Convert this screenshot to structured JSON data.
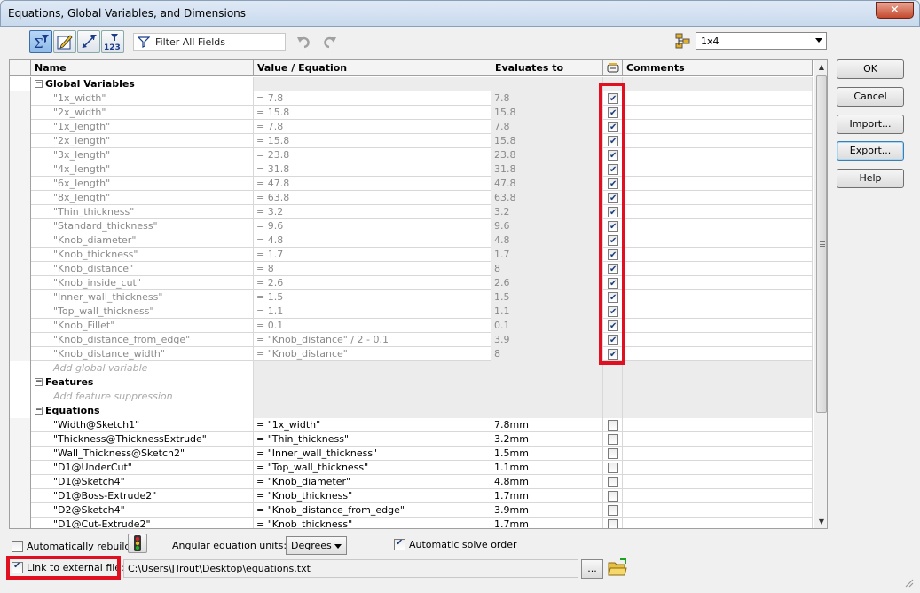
{
  "window": {
    "title": "Equations, Global Variables, and Dimensions",
    "close_label": "✕"
  },
  "toolbar": {
    "buttons": [
      {
        "name": "equation-view-button",
        "icon": "sigma-filter-icon"
      },
      {
        "name": "sketch-equation-view-button",
        "icon": "pencil-edit-icon"
      },
      {
        "name": "dimension-view-button",
        "icon": "dimension-icon"
      },
      {
        "name": "ordered-view-button",
        "icon": "filter-123-icon"
      }
    ],
    "filter_placeholder": "Filter All Fields",
    "configuration": "1x4"
  },
  "columns": [
    "Name",
    "Value / Equation",
    "Evaluates to",
    "",
    "Comments"
  ],
  "sections": {
    "global_variables": "Global Variables",
    "add_global_variable": "Add global variable",
    "features": "Features",
    "add_feature_suppression": "Add feature suppression",
    "equations": "Equations"
  },
  "global_variables": [
    {
      "name": "\"1x_width\"",
      "value": "= 7.8",
      "evaluates": "7.8",
      "checked": true
    },
    {
      "name": "\"2x_width\"",
      "value": "= 15.8",
      "evaluates": "15.8",
      "checked": true
    },
    {
      "name": "\"1x_length\"",
      "value": "= 7.8",
      "evaluates": "7.8",
      "checked": true
    },
    {
      "name": "\"2x_length\"",
      "value": "= 15.8",
      "evaluates": "15.8",
      "checked": true
    },
    {
      "name": "\"3x_length\"",
      "value": "= 23.8",
      "evaluates": "23.8",
      "checked": true
    },
    {
      "name": "\"4x_length\"",
      "value": "= 31.8",
      "evaluates": "31.8",
      "checked": true
    },
    {
      "name": "\"6x_length\"",
      "value": "= 47.8",
      "evaluates": "47.8",
      "checked": true
    },
    {
      "name": "\"8x_length\"",
      "value": "= 63.8",
      "evaluates": "63.8",
      "checked": true
    },
    {
      "name": "\"Thin_thickness\"",
      "value": "= 3.2",
      "evaluates": "3.2",
      "checked": true
    },
    {
      "name": "\"Standard_thickness\"",
      "value": "= 9.6",
      "evaluates": "9.6",
      "checked": true
    },
    {
      "name": "\"Knob_diameter\"",
      "value": "= 4.8",
      "evaluates": "4.8",
      "checked": true
    },
    {
      "name": "\"Knob_thickness\"",
      "value": "= 1.7",
      "evaluates": "1.7",
      "checked": true
    },
    {
      "name": "\"Knob_distance\"",
      "value": "= 8",
      "evaluates": "8",
      "checked": true
    },
    {
      "name": "\"Knob_inside_cut\"",
      "value": "= 2.6",
      "evaluates": "2.6",
      "checked": true
    },
    {
      "name": "\"Inner_wall_thickness\"",
      "value": "= 1.5",
      "evaluates": "1.5",
      "checked": true
    },
    {
      "name": "\"Top_wall_thickness\"",
      "value": "= 1.1",
      "evaluates": "1.1",
      "checked": true
    },
    {
      "name": "\"Knob_Fillet\"",
      "value": "= 0.1",
      "evaluates": "0.1",
      "checked": true
    },
    {
      "name": "\"Knob_distance_from_edge\"",
      "value": "= \"Knob_distance\" / 2 - 0.1",
      "evaluates": "3.9",
      "checked": true
    },
    {
      "name": "\"Knob_distance_width\"",
      "value": "= \"Knob_distance\"",
      "evaluates": "8",
      "checked": true
    }
  ],
  "equations": [
    {
      "name": "\"Width@Sketch1\"",
      "value": "= \"1x_width\"",
      "evaluates": "7.8mm",
      "checked": false
    },
    {
      "name": "\"Thickness@ThicknessExtrude\"",
      "value": "= \"Thin_thickness\"",
      "evaluates": "3.2mm",
      "checked": false
    },
    {
      "name": "\"Wall_Thickness@Sketch2\"",
      "value": "= \"Inner_wall_thickness\"",
      "evaluates": "1.5mm",
      "checked": false
    },
    {
      "name": "\"D1@UnderCut\"",
      "value": "= \"Top_wall_thickness\"",
      "evaluates": "1.1mm",
      "checked": false
    },
    {
      "name": "\"D1@Sketch4\"",
      "value": "= \"Knob_diameter\"",
      "evaluates": "4.8mm",
      "checked": false
    },
    {
      "name": "\"D1@Boss-Extrude2\"",
      "value": "= \"Knob_thickness\"",
      "evaluates": "1.7mm",
      "checked": false
    },
    {
      "name": "\"D2@Sketch4\"",
      "value": "= \"Knob_distance_from_edge\"",
      "evaluates": "3.9mm",
      "checked": false
    },
    {
      "name": "\"D1@Cut-Extrude2\"",
      "value": "= \"Knob_thickness\"",
      "evaluates": "1.7mm",
      "checked": false
    }
  ],
  "side_buttons": {
    "ok": "OK",
    "cancel": "Cancel",
    "import": "Import...",
    "export": "Export...",
    "help": "Help"
  },
  "bottom": {
    "auto_rebuild": "Automatically rebuild",
    "auto_rebuild_checked": false,
    "angular_label": "Angular equation units:",
    "angular_value": "Degrees",
    "auto_solve": "Automatic solve order",
    "auto_solve_checked": true,
    "link_external": "Link to external file:",
    "link_external_checked": true,
    "file_path": "C:\\Users\\JTrout\\Desktop\\equations.txt",
    "browse_label": "..."
  },
  "colors": {
    "highlight": "#e01020"
  }
}
